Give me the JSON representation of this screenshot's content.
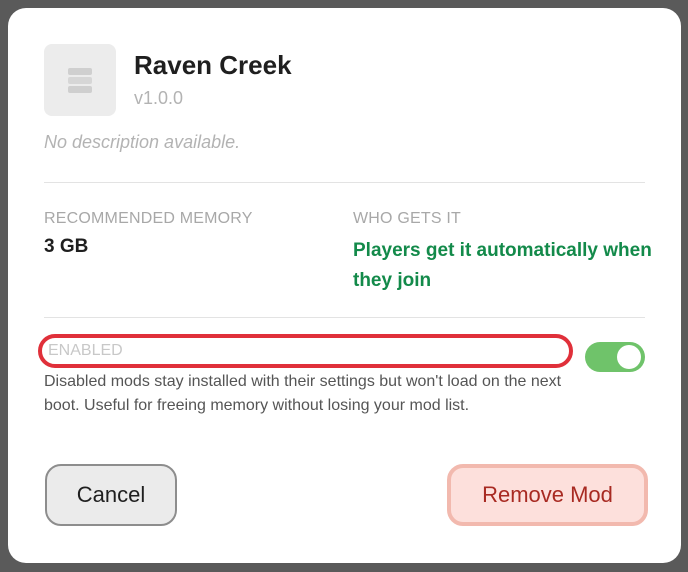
{
  "mod": {
    "name": "Raven Creek",
    "version": "v1.0.0",
    "description": "No description available.",
    "icon": "stack-layers-icon"
  },
  "details": {
    "memory_label": "RECOMMENDED MEMORY",
    "memory_value": "3 GB",
    "who_label": "WHO GETS IT",
    "who_value": "Players get it automatically when they join"
  },
  "enabled": {
    "label": "ENABLED",
    "state": true,
    "help": "Disabled mods stay installed with their settings but won't load on the next boot. Useful for freeing memory without losing your mod list."
  },
  "actions": {
    "cancel_label": "Cancel",
    "remove_label": "Remove Mod"
  },
  "colors": {
    "accent_green": "#138a4a",
    "toggle_on": "#6fc36a",
    "danger": "#a82a22",
    "highlight": "#e0303a"
  }
}
